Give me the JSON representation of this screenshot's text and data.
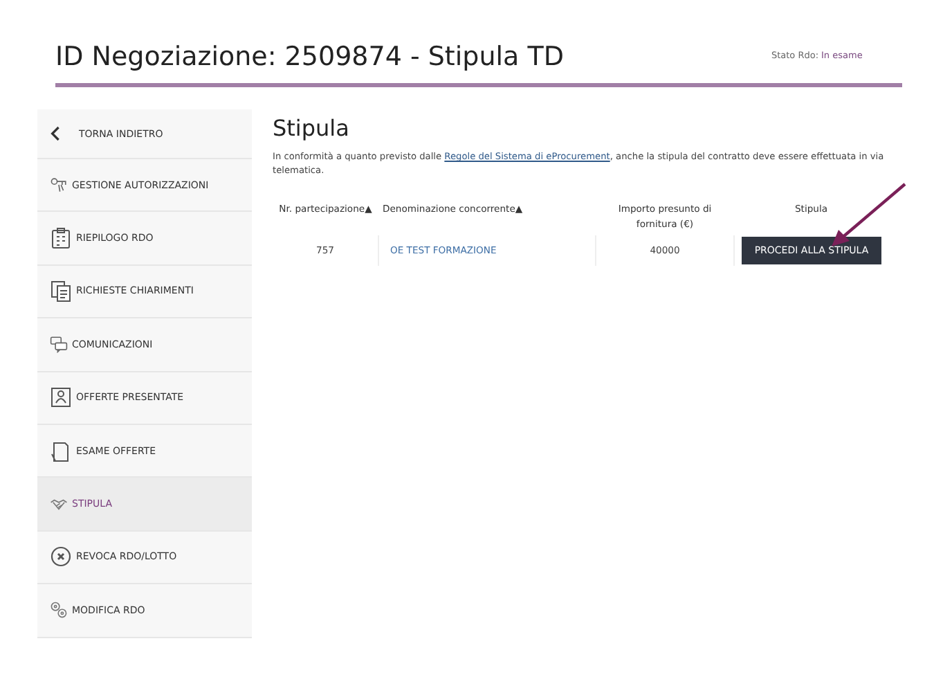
{
  "header": {
    "title": "ID Negoziazione: 2509874 - Stipula TD",
    "status_label": "Stato Rdo:",
    "status_value": "In esame"
  },
  "sidebar": {
    "items": [
      {
        "label": "TORNA INDIETRO",
        "kind": "back",
        "selected": false
      },
      {
        "label": "GESTIONE AUTORIZZAZIONI",
        "kind": "keys",
        "selected": false
      },
      {
        "label": "RIEPILOGO RDO",
        "kind": "clipboard",
        "selected": false
      },
      {
        "label": "RICHIESTE CHIARIMENTI",
        "kind": "docs",
        "selected": false
      },
      {
        "label": "COMUNICAZIONI",
        "kind": "chat",
        "selected": false
      },
      {
        "label": "OFFERTE PRESENTATE",
        "kind": "person",
        "selected": false
      },
      {
        "label": "ESAME OFFERTE",
        "kind": "pages",
        "selected": false
      },
      {
        "label": "STIPULA",
        "kind": "handshake",
        "selected": true
      },
      {
        "label": "REVOCA RDO/LOTTO",
        "kind": "revoke",
        "selected": false
      },
      {
        "label": "MODIFICA RDO",
        "kind": "gears",
        "selected": false
      }
    ]
  },
  "main": {
    "title": "Stipula",
    "intro_before": "In conformità a quanto previsto dalle",
    "intro_link": "Regole del Sistema di eProcurement",
    "intro_after": ", anche la stipula del contratto deve essere effettuata in via telematica.",
    "table": {
      "columns": [
        {
          "label": "Nr. partecipazione",
          "sort_mark": "▲"
        },
        {
          "label": "Denominazione concorrente",
          "sort_mark": "▲"
        },
        {
          "label": "Importo presunto di fornitura (€)"
        },
        {
          "label": "Stipula"
        }
      ],
      "rows": [
        {
          "number": "757",
          "name": "OE TEST FORMAZIONE",
          "amount": "40000",
          "action": "PROCEDI ALLA STIPULA"
        }
      ]
    }
  }
}
